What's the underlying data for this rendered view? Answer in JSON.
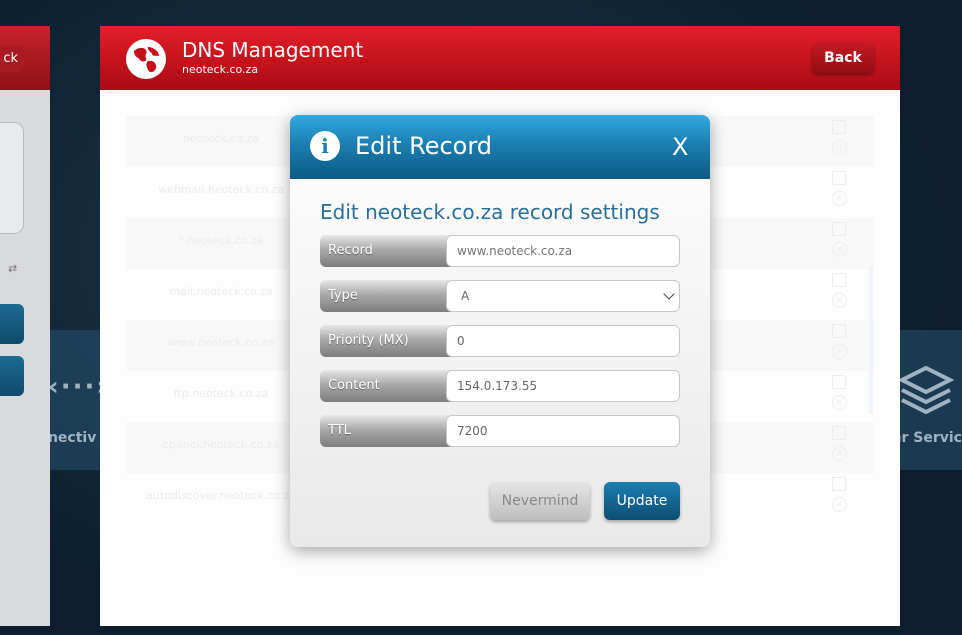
{
  "background": {
    "left_label": "nnectiv",
    "right_label": "er Servic"
  },
  "ghost_panel": {
    "back_label": "ck"
  },
  "dns": {
    "title": "DNS Management",
    "domain": "neoteck.co.za",
    "back_label": "Back",
    "records": [
      {
        "host": "neoteck.co.za"
      },
      {
        "host": "webmail.neoteck.co.za"
      },
      {
        "host": "*.neoteck.co.za"
      },
      {
        "host": "mail.neoteck.co.za"
      },
      {
        "host": "www.neoteck.co.za"
      },
      {
        "host": "ftp.neoteck.co.za"
      },
      {
        "host": "cpanel.neoteck.co.za"
      },
      {
        "host": "autodiscover.neoteck.co.za"
      }
    ]
  },
  "modal": {
    "title": "Edit Record",
    "close_label": "X",
    "subtitle": "Edit neoteck.co.za record settings",
    "fields": {
      "record": {
        "label": "Record",
        "placeholder": "www.neoteck.co.za",
        "value": ""
      },
      "type": {
        "label": "Type",
        "value": "A"
      },
      "priority": {
        "label": "Priority (MX)",
        "value": "0"
      },
      "content": {
        "label": "Content",
        "value": "154.0.173.55"
      },
      "ttl": {
        "label": "TTL",
        "value": "7200"
      }
    },
    "nevermind_label": "Nevermind",
    "update_label": "Update"
  },
  "colors": {
    "header_red": "#c3121b",
    "modal_blue": "#1b7fb3",
    "subtitle_blue": "#2a6f99"
  }
}
